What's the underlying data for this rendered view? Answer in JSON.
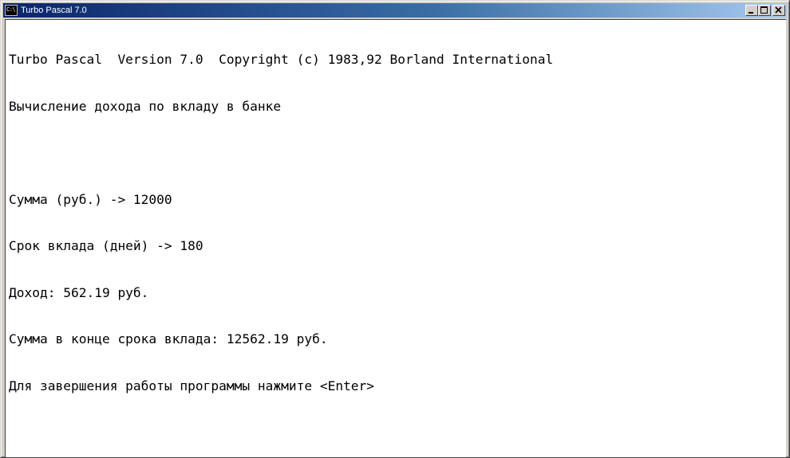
{
  "window": {
    "title": "Turbo Pascal 7.0",
    "icon_text": "C:\\"
  },
  "console": {
    "lines": [
      "Turbo Pascal  Version 7.0  Copyright (c) 1983,92 Borland International",
      "Вычисление дохода по вкладу в банке",
      "",
      "Сумма (руб.) -> 12000",
      "Срок вклада (дней) -> 180",
      "Доход: 562.19 руб.",
      "Сумма в конце срока вклада: 12562.19 руб.",
      "Для завершения работы программы нажмите <Enter>"
    ]
  }
}
